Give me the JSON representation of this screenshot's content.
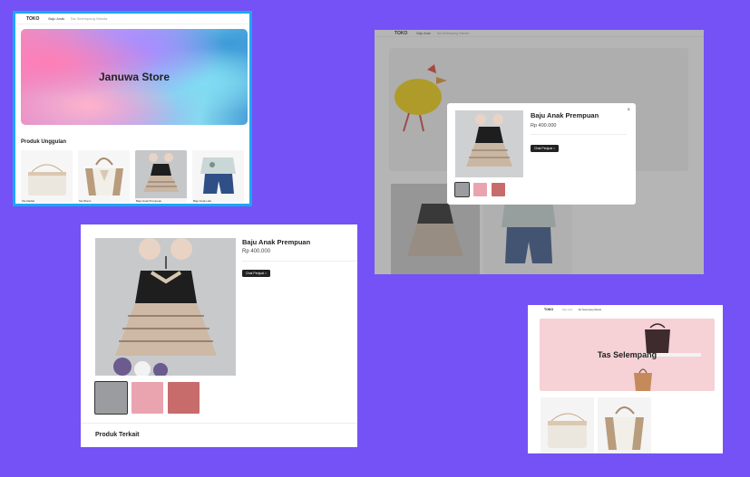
{
  "nav": {
    "logo": "TOKO",
    "link1": "Baju Anak",
    "link2": "Tas Selempang Wanita"
  },
  "home": {
    "hero_title": "Januwa Store",
    "section_title": "Produk Unggulan",
    "products": [
      {
        "name": "Tas Radial"
      },
      {
        "name": "Tas Branz"
      },
      {
        "name": "Baju Anak Prempuan"
      },
      {
        "name": "Baju Anak Laki"
      }
    ]
  },
  "modal": {
    "title": "Baju Anak Prempuan",
    "price": "Rp 400.000",
    "button": "Chat Penjual",
    "close": "×"
  },
  "detail": {
    "title": "Baju Anak Prempuan",
    "price": "Rp 400.000",
    "button": "Chat Penjual",
    "related_title": "Produk Terkait"
  },
  "category": {
    "hero_title": "Tas Selempang"
  },
  "colors": {
    "background": "#7452f5",
    "highlight_border": "#1aa8f2",
    "button": "#222222",
    "category_banner": "#f6d1d6"
  }
}
